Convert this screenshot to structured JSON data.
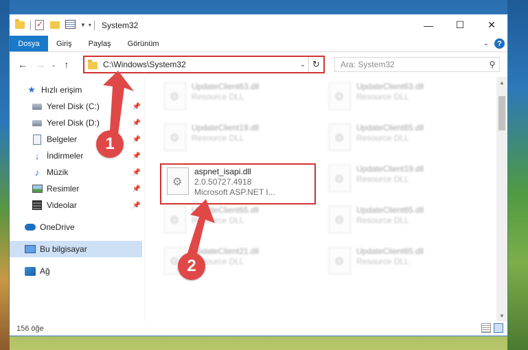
{
  "window": {
    "title": "System32"
  },
  "ribbon": {
    "tabs": [
      "Dosya",
      "Giriş",
      "Paylaş",
      "Görünüm"
    ]
  },
  "address": {
    "path": "C:\\Windows\\System32"
  },
  "search": {
    "placeholder": "Ara: System32"
  },
  "sidebar": {
    "items": [
      {
        "label": "Hızlı erişim",
        "icon": "star-icon",
        "pinned": false
      },
      {
        "label": "Yerel Disk (C:)",
        "icon": "drive-icon",
        "pinned": true
      },
      {
        "label": "Yerel Disk (D:)",
        "icon": "drive-icon",
        "pinned": true
      },
      {
        "label": "Belgeler",
        "icon": "document-icon",
        "pinned": true
      },
      {
        "label": "İndirmeler",
        "icon": "download-icon",
        "pinned": true
      },
      {
        "label": "Müzik",
        "icon": "music-icon",
        "pinned": true
      },
      {
        "label": "Resimler",
        "icon": "pictures-icon",
        "pinned": true
      },
      {
        "label": "Videolar",
        "icon": "video-icon",
        "pinned": true
      },
      {
        "label": "OneDrive",
        "icon": "cloud-icon",
        "pinned": false
      },
      {
        "label": "Bu bilgisayar",
        "icon": "computer-icon",
        "pinned": false,
        "selected": true
      },
      {
        "label": "Ağ",
        "icon": "network-icon",
        "pinned": false
      }
    ]
  },
  "files": {
    "left": [
      {
        "name": "UpdateClient63.dll",
        "desc": "Resource DLL"
      },
      {
        "name": "UpdateClient19.dll",
        "desc": "Resource DLL"
      },
      {
        "name": "UpdateClient65.dll",
        "desc": "Resource DLL"
      },
      {
        "name": "UpdateClient21.dll",
        "desc": "Resource DLL"
      }
    ],
    "right": [
      {
        "name": "UpdateClient63.dll",
        "desc": "Resource DLL"
      },
      {
        "name": "UpdateClient65.dll",
        "desc": "Resource DLL"
      },
      {
        "name": "UpdateClient19.dll",
        "desc": "Resource DLL"
      },
      {
        "name": "UpdateClient65.dll",
        "desc": "Resource DLL"
      },
      {
        "name": "UpdateClient65.dll",
        "desc": "Resource DLL"
      }
    ],
    "highlighted": {
      "name": "aspnet_isapi.dll",
      "version": "2.0.50727.4918",
      "desc": "Microsoft ASP.NET I..."
    }
  },
  "status": {
    "count": "156 öğe"
  },
  "markers": [
    "1",
    "2"
  ],
  "colors": {
    "highlight": "#d23232",
    "marker": "#e04848",
    "accent": "#1979ca"
  }
}
